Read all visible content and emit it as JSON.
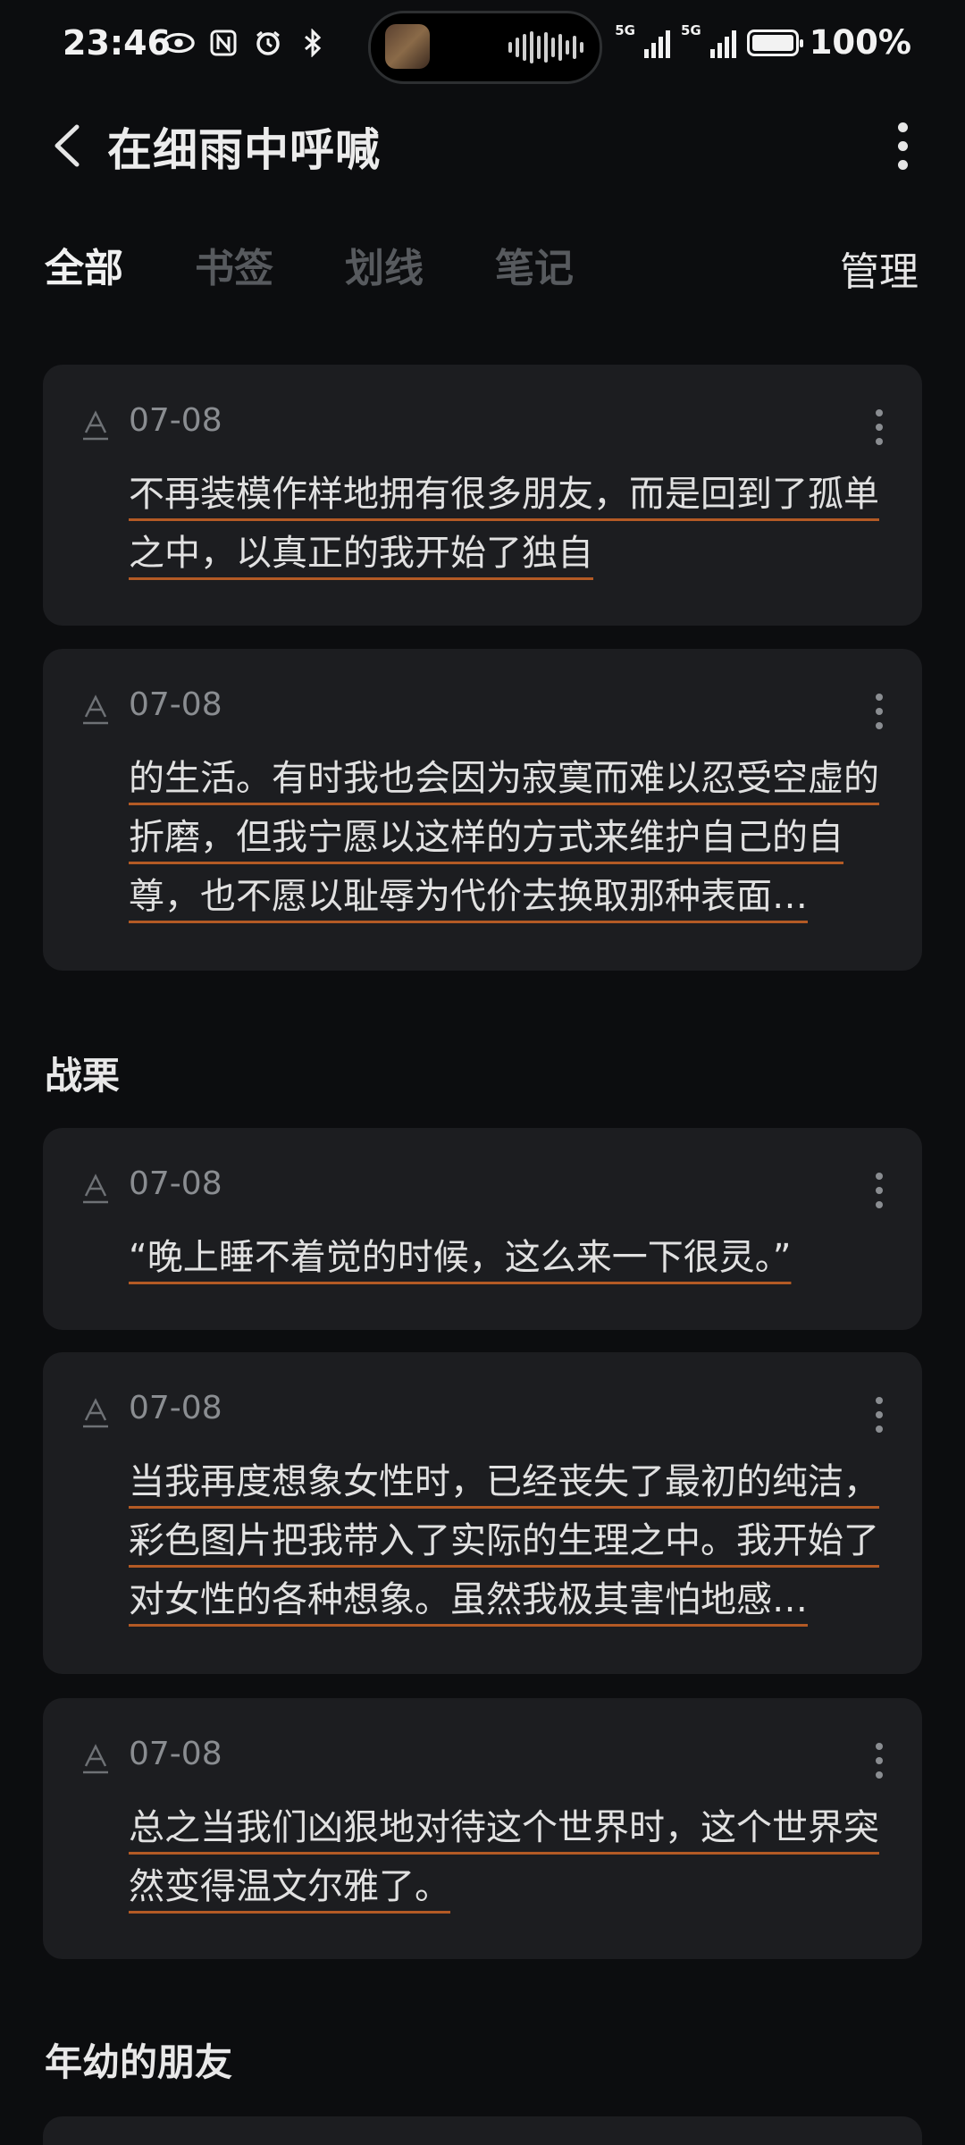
{
  "status_bar": {
    "time": "23:46",
    "left_icons": [
      "eye-icon",
      "nfc-icon",
      "alarm-icon",
      "bluetooth-icon"
    ],
    "signal_1_label": "5G",
    "signal_2_label": "5G",
    "battery_percent": "100%",
    "battery_level": 1.0
  },
  "header": {
    "title": "在细雨中呼喊"
  },
  "tabs": [
    {
      "label": "全部",
      "active": true
    },
    {
      "label": "书签",
      "active": false
    },
    {
      "label": "划线",
      "active": false
    },
    {
      "label": "笔记",
      "active": false
    }
  ],
  "manage_label": "管理",
  "sections": [
    {
      "title": "",
      "cards": [
        {
          "date": "07-08",
          "text": "不再装模作样地拥有很多朋友，而是回到了孤单之中，以真正的我开始了独自"
        },
        {
          "date": "07-08",
          "text": "的生活。有时我也会因为寂寞而难以忍受空虚的折磨，但我宁愿以这样的方式来维护自己的自尊，也不愿以耻辱为代价去换取那种表面…"
        }
      ]
    },
    {
      "title": "战栗",
      "cards": [
        {
          "date": "07-08",
          "text": "“晚上睡不着觉的时候，这么来一下很灵。”"
        },
        {
          "date": "07-08",
          "text": "当我再度想象女性时，已经丧失了最初的纯洁，彩色图片把我带入了实际的生理之中。我开始了对女性的各种想象。虽然我极其害怕地感…"
        },
        {
          "date": "07-08",
          "text": "总之当我们凶狠地对待这个世界时，这个世界突然变得温文尔雅了。"
        }
      ]
    },
    {
      "title": "年幼的朋友",
      "cards": []
    }
  ],
  "colors": {
    "background": "#0c0d0f",
    "card": "#1c1d20",
    "underline_accent": "#b35a25",
    "inactive_tab": "#575a5e"
  }
}
